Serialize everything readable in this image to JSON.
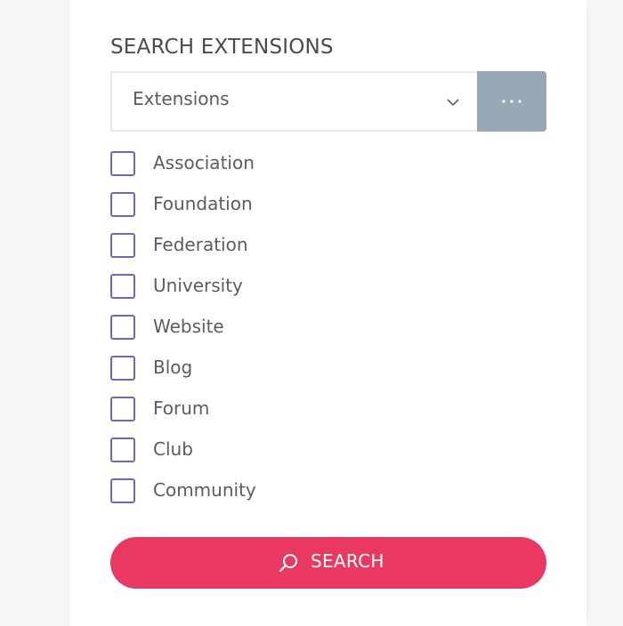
{
  "heading": "SEARCH EXTENSIONS",
  "select": {
    "value": "Extensions",
    "chevron_icon": "chevron-down-icon",
    "more_icon": "ellipsis-icon"
  },
  "options": [
    {
      "label": "Association",
      "checked": false
    },
    {
      "label": "Foundation",
      "checked": false
    },
    {
      "label": "Federation",
      "checked": false
    },
    {
      "label": "University",
      "checked": false
    },
    {
      "label": "Website",
      "checked": false
    },
    {
      "label": "Blog",
      "checked": false
    },
    {
      "label": "Forum",
      "checked": false
    },
    {
      "label": "Club",
      "checked": false
    },
    {
      "label": "Community",
      "checked": false
    }
  ],
  "search_button": {
    "label": "SEARCH",
    "icon": "search-icon"
  },
  "colors": {
    "accent": "#e93963",
    "checkbox_border": "#7a62b8",
    "more_button": "#98a8b4",
    "text": "#5b5b63"
  }
}
